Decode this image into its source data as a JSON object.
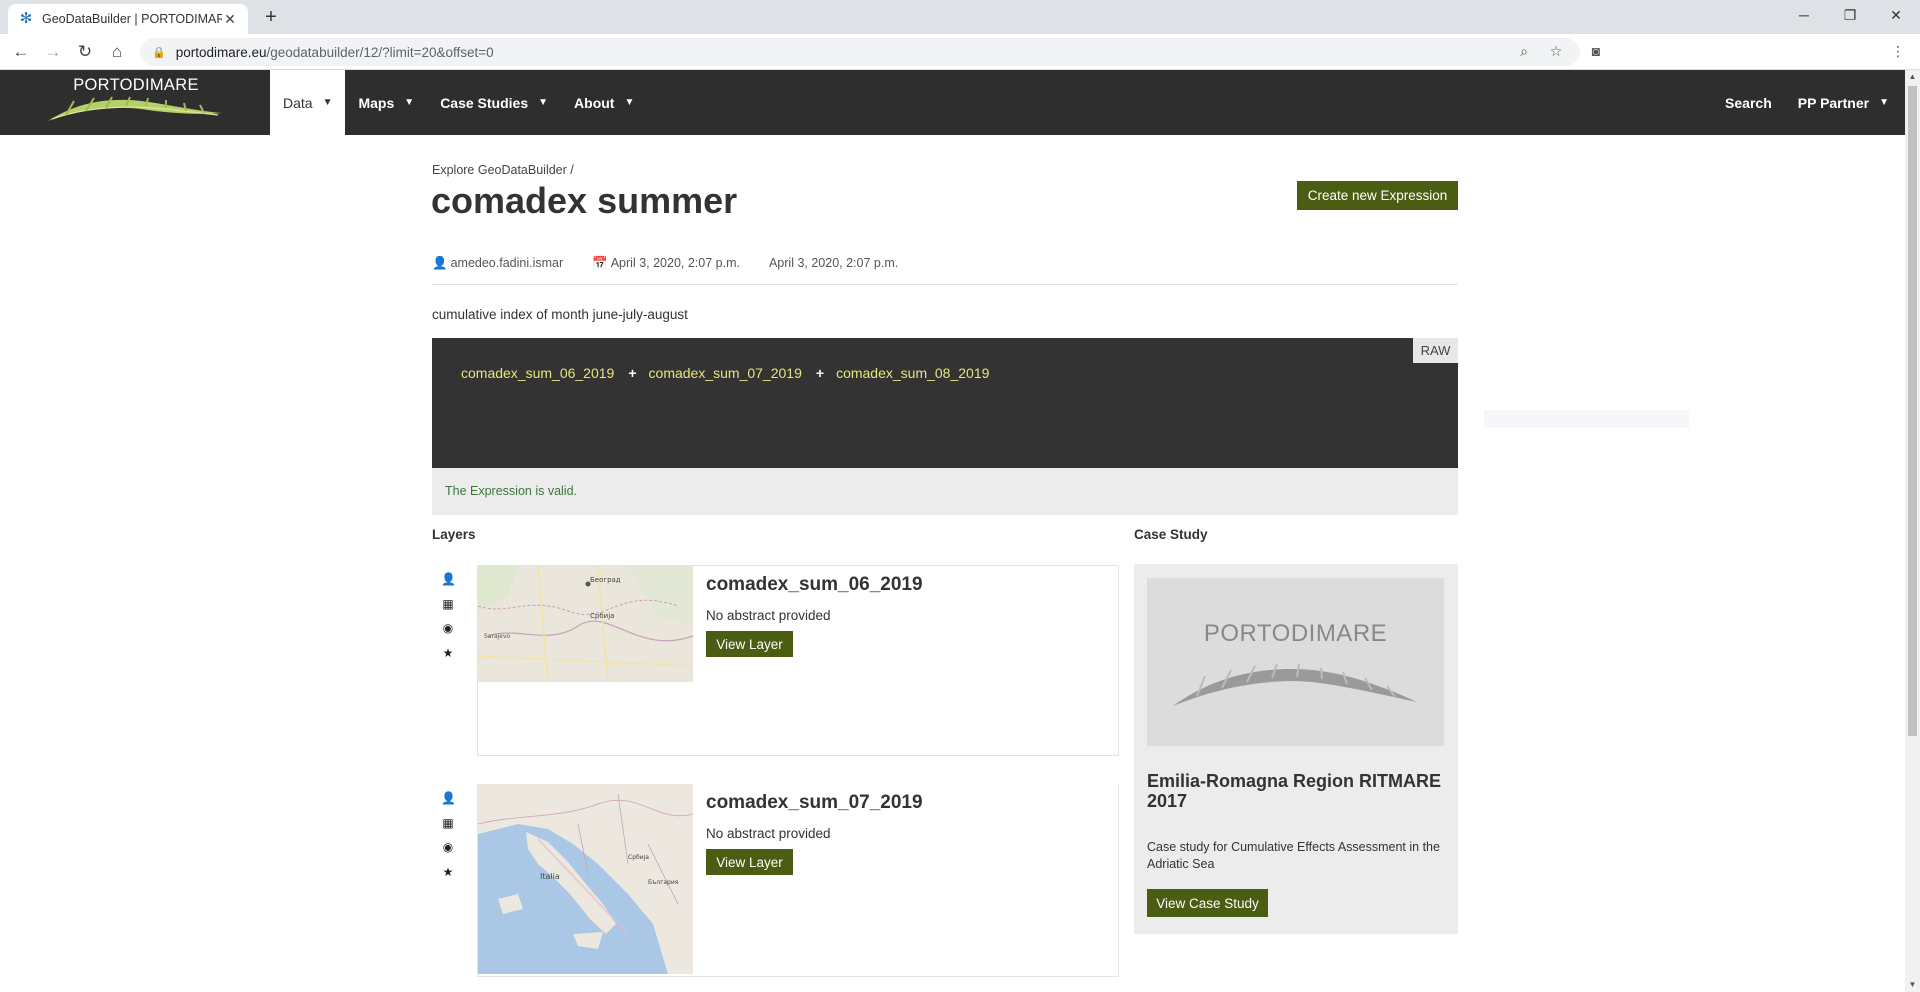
{
  "browser": {
    "tab_title": "GeoDataBuilder | PORTODIMARE",
    "url_host": "portodimare.eu",
    "url_path": "/geodatabuilder/12/?limit=20&offset=0"
  },
  "header": {
    "logo_text": "PORTODIMARE",
    "nav": [
      "Data",
      "Maps",
      "Case Studies",
      "About"
    ],
    "search_label": "Search",
    "user_label": "PP Partner"
  },
  "page": {
    "breadcrumb": "Explore GeoDataBuilder /",
    "title": "comadex summer",
    "create_button": "Create new Expression",
    "author": "amedeo.fadini.ismar",
    "created": "April 3, 2020, 2:07 p.m.",
    "modified": "April 3, 2020, 2:07 p.m.",
    "description": "cumulative index of month june-july-august"
  },
  "expression": {
    "raw_label": "RAW",
    "terms": [
      "comadex_sum_06_2019",
      "comadex_sum_07_2019",
      "comadex_sum_08_2019"
    ],
    "operator": "+",
    "validation": "The Expression is valid."
  },
  "layers": {
    "heading": "Layers",
    "items": [
      {
        "name": "comadex_sum_06_2019",
        "abstract": "No abstract provided",
        "button": "View Layer"
      },
      {
        "name": "comadex_sum_07_2019",
        "abstract": "No abstract provided",
        "button": "View Layer"
      }
    ]
  },
  "case_study": {
    "heading": "Case Study",
    "image_text": "PORTODIMARE",
    "title": "Emilia-Romagna Region RITMARE 2017",
    "description": "Case study for Cumulative Effects Assessment in the Adriatic Sea",
    "button": "View Case Study"
  },
  "map_labels": {
    "map1": [
      "Београд",
      "Србија",
      "Sarajevo"
    ],
    "map2": [
      "Italia",
      "Србија",
      "България"
    ]
  },
  "colors": {
    "header_bg": "#2e2e2e",
    "button_green": "#4a5d12",
    "expr_bg": "#333333",
    "expr_term": "#e7e57c",
    "valid_text": "#3c763d"
  }
}
